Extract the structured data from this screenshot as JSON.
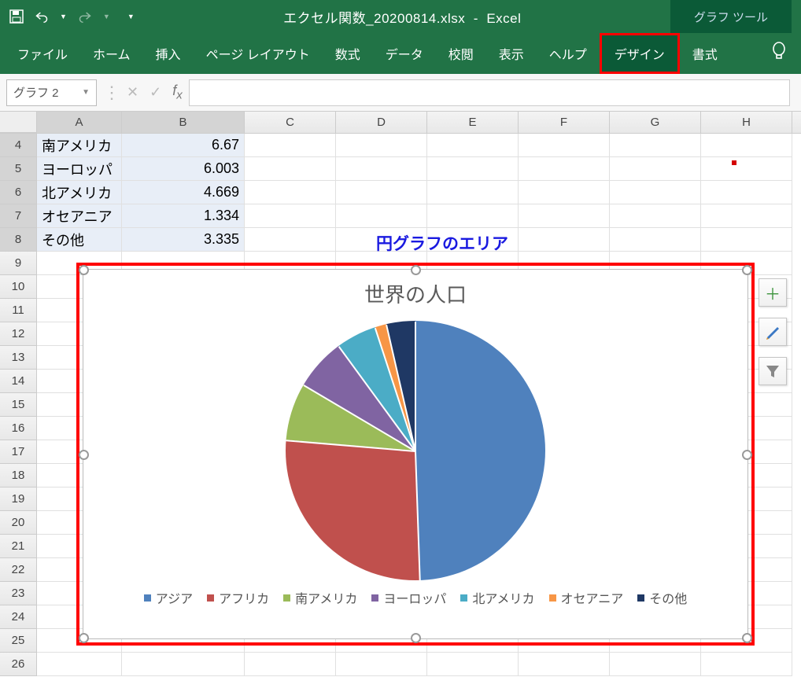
{
  "titlebar": {
    "filename": "エクセル関数_20200814.xlsx",
    "app": "Excel",
    "chart_tools": "グラフ ツール"
  },
  "ribbon": {
    "tabs": [
      "ファイル",
      "ホーム",
      "挿入",
      "ページ レイアウト",
      "数式",
      "データ",
      "校閲",
      "表示",
      "ヘルプ",
      "デザイン",
      "書式"
    ]
  },
  "namebox": "グラフ 2",
  "columns": [
    "A",
    "B",
    "C",
    "D",
    "E",
    "F",
    "G",
    "H"
  ],
  "rows": [
    {
      "n": "4",
      "a": "南アメリカ",
      "b": "6.67",
      "sel": true
    },
    {
      "n": "5",
      "a": "ヨーロッパ",
      "b": "6.003",
      "sel": true
    },
    {
      "n": "6",
      "a": "北アメリカ",
      "b": "4.669",
      "sel": true
    },
    {
      "n": "7",
      "a": "オセアニア",
      "b": "1.334",
      "sel": true
    },
    {
      "n": "8",
      "a": "その他",
      "b": "3.335",
      "sel": true
    },
    {
      "n": "9"
    },
    {
      "n": "10"
    },
    {
      "n": "11"
    },
    {
      "n": "12"
    },
    {
      "n": "13"
    },
    {
      "n": "14"
    },
    {
      "n": "15"
    },
    {
      "n": "16"
    },
    {
      "n": "17"
    },
    {
      "n": "18"
    },
    {
      "n": "19"
    },
    {
      "n": "20"
    },
    {
      "n": "21"
    },
    {
      "n": "22"
    },
    {
      "n": "23"
    },
    {
      "n": "24"
    },
    {
      "n": "25"
    },
    {
      "n": "26"
    }
  ],
  "annotation": "円グラフのエリア",
  "chart_data": {
    "type": "pie",
    "title": "世界の人口",
    "series": [
      {
        "name": "アジア",
        "value": 45.98,
        "color": "#4f81bd"
      },
      {
        "name": "アフリカ",
        "value": 25,
        "color": "#c0504d"
      },
      {
        "name": "南アメリカ",
        "value": 6.67,
        "color": "#9bbb59"
      },
      {
        "name": "ヨーロッパ",
        "value": 6.003,
        "color": "#8064a2"
      },
      {
        "name": "北アメリカ",
        "value": 4.669,
        "color": "#4bacc6"
      },
      {
        "name": "オセアニア",
        "value": 1.334,
        "color": "#f79646"
      },
      {
        "name": "その他",
        "value": 3.335,
        "color": "#1f3864"
      }
    ]
  }
}
